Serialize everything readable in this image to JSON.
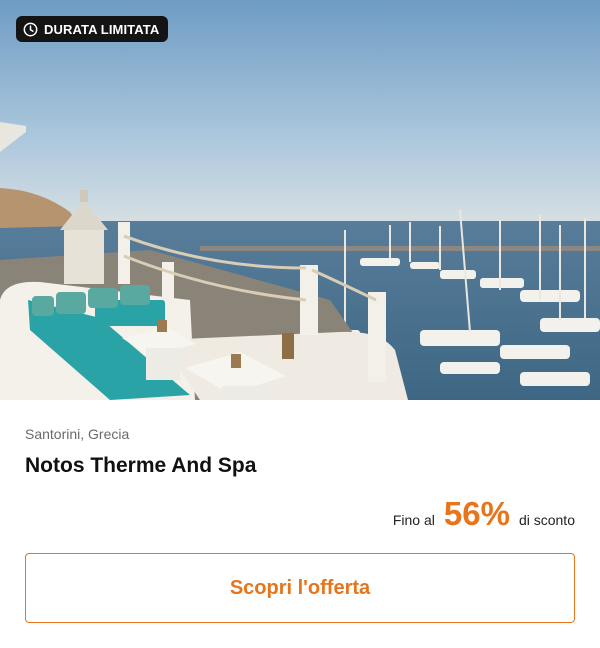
{
  "badge": {
    "label": "DURATA LIMITATA",
    "icon": "clock-icon"
  },
  "hero": {
    "image": "hotel-terrace-harbor-photo"
  },
  "offer": {
    "location": "Santorini, Grecia",
    "title": "Notos Therme And Spa",
    "discount_prefix": "Fino al",
    "discount_value": "56%",
    "discount_suffix": "di sconto"
  },
  "cta": {
    "label": "Scopri l'offerta"
  },
  "colors": {
    "accent": "#e8741c",
    "badge_bg": "#141414",
    "muted_text": "#6b6b6b"
  }
}
